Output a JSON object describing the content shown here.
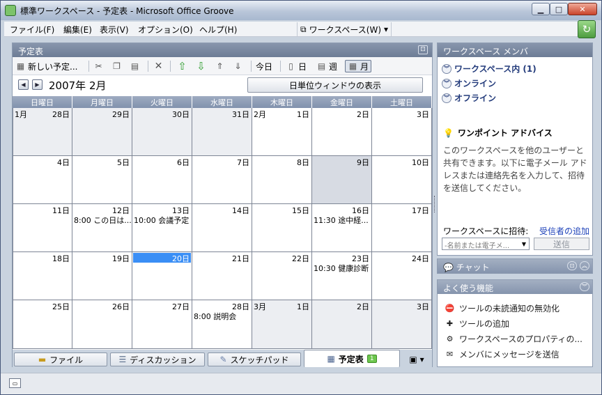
{
  "window": {
    "title": "標準ワークスペース - 予定表 - Microsoft Office Groove"
  },
  "menu": [
    "ファイル(F)",
    "編集(E)",
    "表示(V)",
    "オプション(O)",
    "ヘルプ(H)"
  ],
  "workspace_menu": "ワークスペース(W)",
  "calendar_panel": {
    "title": "予定表",
    "toolbar": {
      "new": "新しい予定...",
      "today": "今日",
      "day": "日",
      "week": "週",
      "month": "月"
    },
    "month_title": "2007年 2月",
    "day_window_button": "日単位ウィンドウの表示",
    "weekdays": [
      "日曜日",
      "月曜日",
      "火曜日",
      "水曜日",
      "木曜日",
      "金曜日",
      "土曜日"
    ],
    "weeks": [
      [
        {
          "day": "28日",
          "month_label": "1月",
          "other": true,
          "event": ""
        },
        {
          "day": "29日",
          "month_label": "",
          "other": true,
          "event": ""
        },
        {
          "day": "30日",
          "month_label": "",
          "other": true,
          "event": ""
        },
        {
          "day": "31日",
          "month_label": "",
          "other": true,
          "event": ""
        },
        {
          "day": "1日",
          "month_label": "2月",
          "other": false,
          "event": ""
        },
        {
          "day": "2日",
          "month_label": "",
          "other": false,
          "event": ""
        },
        {
          "day": "3日",
          "month_label": "",
          "other": false,
          "event": ""
        }
      ],
      [
        {
          "day": "4日",
          "month_label": "",
          "other": false,
          "event": ""
        },
        {
          "day": "5日",
          "month_label": "",
          "other": false,
          "event": ""
        },
        {
          "day": "6日",
          "month_label": "",
          "other": false,
          "event": ""
        },
        {
          "day": "7日",
          "month_label": "",
          "other": false,
          "event": ""
        },
        {
          "day": "8日",
          "month_label": "",
          "other": false,
          "event": ""
        },
        {
          "day": "9日",
          "month_label": "",
          "other": false,
          "highlight": true,
          "event": ""
        },
        {
          "day": "10日",
          "month_label": "",
          "other": false,
          "event": ""
        }
      ],
      [
        {
          "day": "11日",
          "month_label": "",
          "other": false,
          "event": ""
        },
        {
          "day": "12日",
          "month_label": "",
          "other": false,
          "event": "8:00 この日は..."
        },
        {
          "day": "13日",
          "month_label": "",
          "other": false,
          "event": "10:00 会議予定"
        },
        {
          "day": "14日",
          "month_label": "",
          "other": false,
          "event": ""
        },
        {
          "day": "15日",
          "month_label": "",
          "other": false,
          "event": ""
        },
        {
          "day": "16日",
          "month_label": "",
          "other": false,
          "event": "11:30 途中経..."
        },
        {
          "day": "17日",
          "month_label": "",
          "other": false,
          "event": ""
        }
      ],
      [
        {
          "day": "18日",
          "month_label": "",
          "other": false,
          "event": ""
        },
        {
          "day": "19日",
          "month_label": "",
          "other": false,
          "event": ""
        },
        {
          "day": "20日",
          "month_label": "",
          "other": false,
          "today": true,
          "event": ""
        },
        {
          "day": "21日",
          "month_label": "",
          "other": false,
          "event": ""
        },
        {
          "day": "22日",
          "month_label": "",
          "other": false,
          "event": ""
        },
        {
          "day": "23日",
          "month_label": "",
          "other": false,
          "event": "10:30 健康診断"
        },
        {
          "day": "24日",
          "month_label": "",
          "other": false,
          "event": ""
        }
      ],
      [
        {
          "day": "25日",
          "month_label": "",
          "other": false,
          "event": ""
        },
        {
          "day": "26日",
          "month_label": "",
          "other": false,
          "event": ""
        },
        {
          "day": "27日",
          "month_label": "",
          "other": false,
          "event": ""
        },
        {
          "day": "28日",
          "month_label": "",
          "other": false,
          "event": "8:00 説明会"
        },
        {
          "day": "1日",
          "month_label": "3月",
          "other": true,
          "event": ""
        },
        {
          "day": "2日",
          "month_label": "",
          "other": true,
          "event": ""
        },
        {
          "day": "3日",
          "month_label": "",
          "other": true,
          "event": ""
        }
      ]
    ]
  },
  "tabs": {
    "files": "ファイル",
    "discussion": "ディスカッション",
    "sketchpad": "スケッチパッド",
    "calendar": "予定表",
    "calendar_badge": "1"
  },
  "members_panel": {
    "title": "ワークスペース メンバ",
    "in_workspace": "ワークスペース内 (1)",
    "online": "オンライン",
    "offline": "オフライン",
    "advice_title": "ワンポイント アドバイス",
    "advice_text": "このワークスペースを他のユーザーと共有できます。以下に電子メール アドレスまたは連絡先名を入力して、招待を送信してください。",
    "invite_label": "ワークスペースに招待:",
    "invite_link": "受信者の追加",
    "invite_placeholder": "-名前または電子メ...",
    "send": "送信"
  },
  "chat_panel": {
    "title": "チャット"
  },
  "favorites_panel": {
    "title": "よく使う機能",
    "items": [
      "ツールの未読通知の無効化",
      "ツールの追加",
      "ワークスペースのプロパティの...",
      "メンバにメッセージを送信"
    ]
  }
}
